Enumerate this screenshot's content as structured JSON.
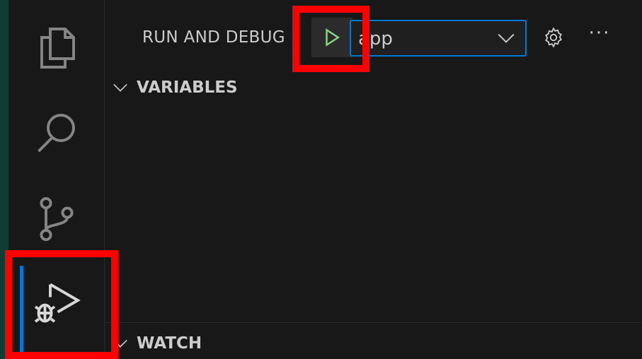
{
  "activity_bar": {
    "items": [
      {
        "name": "explorer",
        "icon": "files-icon"
      },
      {
        "name": "search",
        "icon": "search-icon"
      },
      {
        "name": "source-control",
        "icon": "source-control-icon"
      },
      {
        "name": "run-and-debug",
        "icon": "run-debug-icon",
        "active": true
      }
    ],
    "accent_color": "#0078d4"
  },
  "side_panel": {
    "title": "RUN AND DEBUG",
    "run_button": {
      "icon": "play-icon",
      "color": "#89d185"
    },
    "config_select": {
      "value": "app",
      "icon": "chevron-down-icon"
    },
    "gear_icon": "gear-icon",
    "more_label": "···",
    "sections": {
      "variables": "VARIABLES",
      "watch": "WATCH"
    }
  },
  "highlight_color": "#ff0000"
}
